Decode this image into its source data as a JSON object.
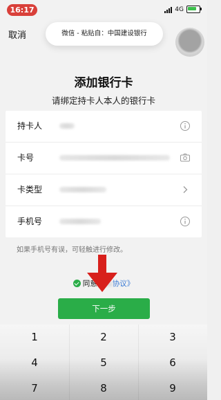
{
  "status": {
    "time": "16:17",
    "network": "4G"
  },
  "header": {
    "cancel_label": "取消",
    "clipboard_text": "微信 - 粘贴自：中国建设银行"
  },
  "page": {
    "title": "添加银行卡",
    "subtitle": "请绑定持卡人本人的银行卡"
  },
  "form": {
    "rows": [
      {
        "label": "持卡人",
        "icon": "info-icon"
      },
      {
        "label": "卡号",
        "icon": "camera-icon"
      },
      {
        "label": "卡类型",
        "icon": "chevron-right-icon"
      },
      {
        "label": "手机号",
        "icon": "info-icon"
      }
    ],
    "hint": "如果手机号有误，可轻触进行修改。"
  },
  "agreement": {
    "prefix": "同意",
    "link": "协议》"
  },
  "next_button": {
    "label": "下一步"
  },
  "keypad": {
    "keys": [
      "1",
      "2",
      "3",
      "4",
      "5",
      "6",
      "7",
      "8",
      "9"
    ]
  },
  "colors": {
    "accent_green": "#2aad48",
    "arrow_red": "#d8201c",
    "link_blue": "#3a7bd5"
  }
}
